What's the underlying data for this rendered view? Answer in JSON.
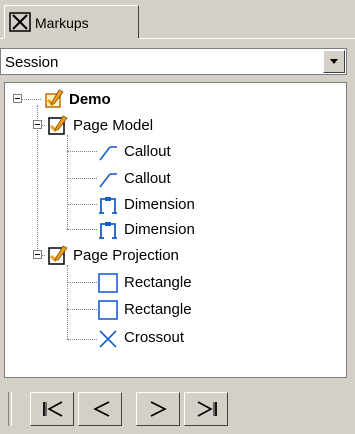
{
  "tab": {
    "label": "Markups",
    "icon": "close-box-icon"
  },
  "session_select": {
    "value": "Session"
  },
  "tree": {
    "root": {
      "label": "Demo",
      "icon": "markup-set-icon"
    },
    "groups": [
      {
        "label": "Page Model",
        "icon": "page-markup-icon",
        "items": [
          {
            "label": "Callout",
            "icon": "callout-icon"
          },
          {
            "label": "Callout",
            "icon": "callout-icon"
          },
          {
            "label": "Dimension",
            "icon": "dimension-icon"
          },
          {
            "label": "Dimension",
            "icon": "dimension-icon"
          }
        ]
      },
      {
        "label": "Page Projection",
        "icon": "page-markup-icon",
        "items": [
          {
            "label": "Rectangle",
            "icon": "rectangle-icon"
          },
          {
            "label": "Rectangle",
            "icon": "rectangle-icon"
          },
          {
            "label": "Crossout",
            "icon": "crossout-icon"
          }
        ]
      }
    ]
  },
  "navigation": {
    "buttons": [
      "first-icon",
      "previous-icon",
      "next-icon",
      "last-icon"
    ]
  },
  "colors": {
    "panel": "#d4d0c8",
    "icon_blue": "#1a5fd0",
    "icon_orange": "#f0a020"
  }
}
